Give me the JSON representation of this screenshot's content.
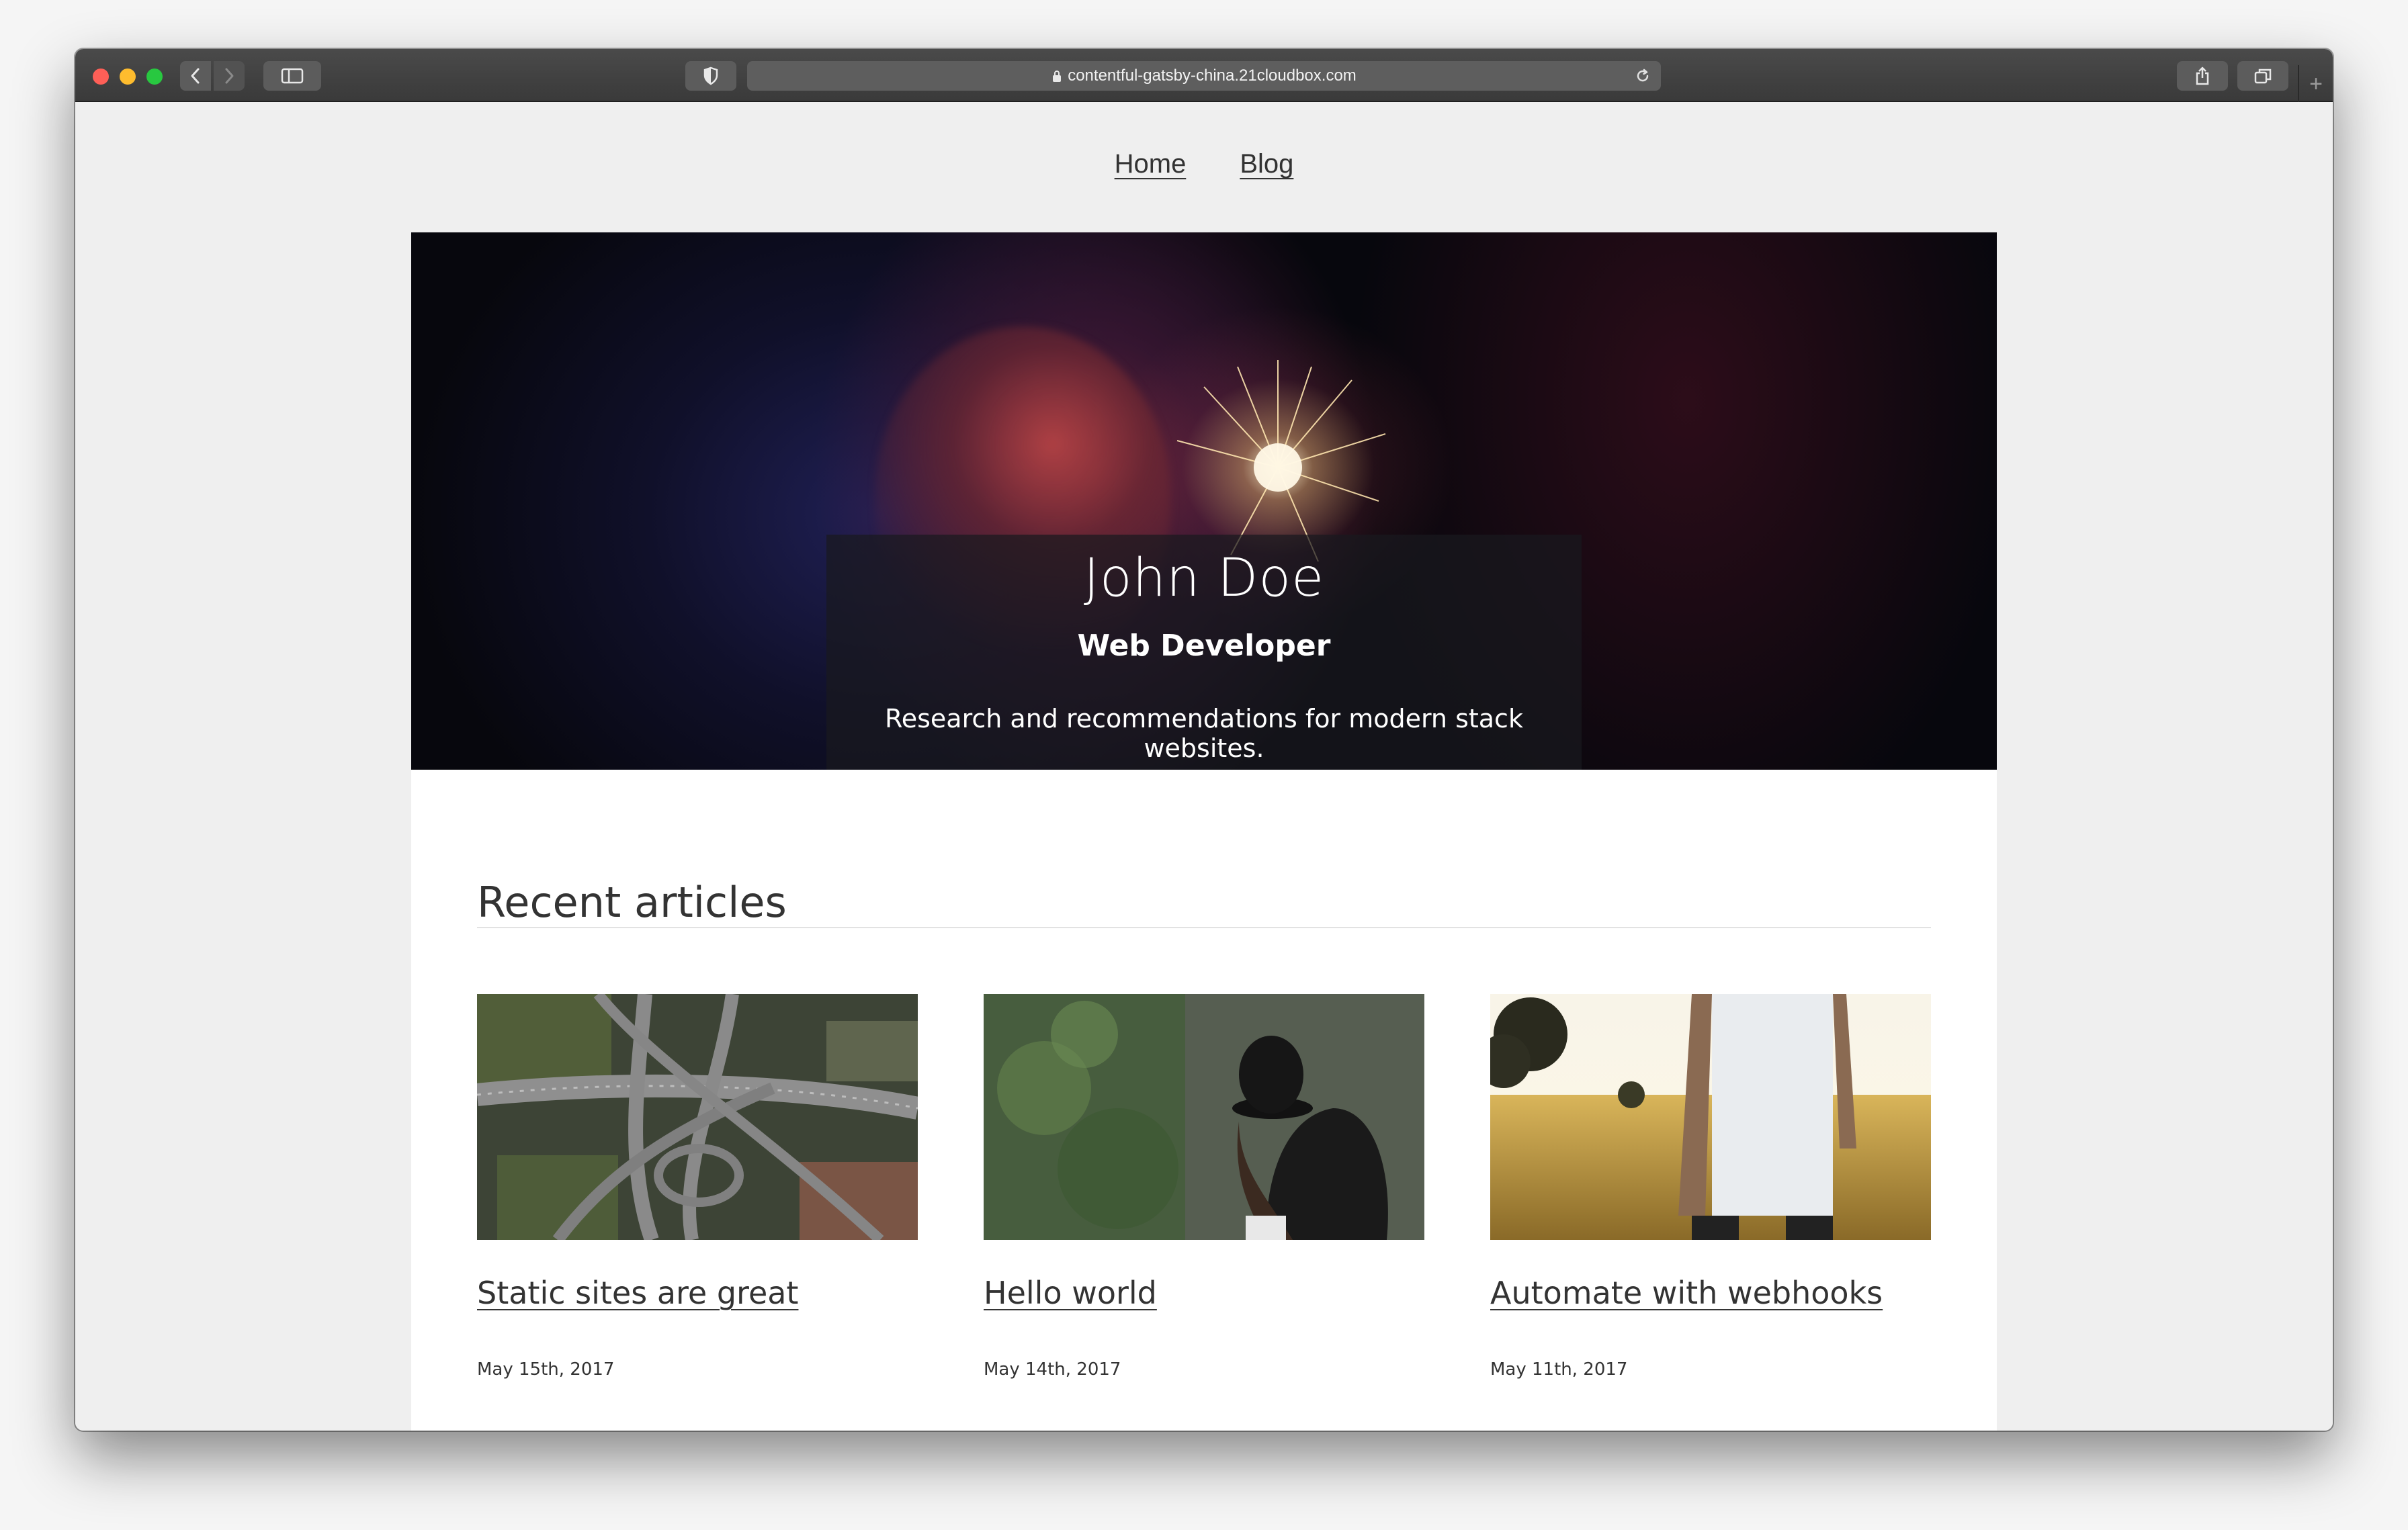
{
  "browser": {
    "url": "contentful-gatsby-china.21cloudbox.com",
    "new_tab": "+"
  },
  "nav": {
    "items": [
      {
        "label": "Home"
      },
      {
        "label": "Blog"
      }
    ]
  },
  "hero": {
    "name": "John Doe",
    "title": "Web Developer",
    "description": "Research and recommendations for modern stack websites."
  },
  "recent": {
    "heading": "Recent articles",
    "articles": [
      {
        "title": "Static sites are great",
        "date": "May 15th, 2017",
        "image": "aerial-highway-interchange"
      },
      {
        "title": "Hello world",
        "date": "May 14th, 2017",
        "image": "woman-in-black-hat-forest"
      },
      {
        "title": "Automate with webhooks",
        "date": "May 11th, 2017",
        "image": "tattooed-person-wheat-field"
      }
    ]
  },
  "colors": {
    "traffic_close": "#fe5f57",
    "traffic_min": "#febc2e",
    "traffic_max": "#28c840",
    "page_bg": "#efefef",
    "text": "#333333"
  }
}
